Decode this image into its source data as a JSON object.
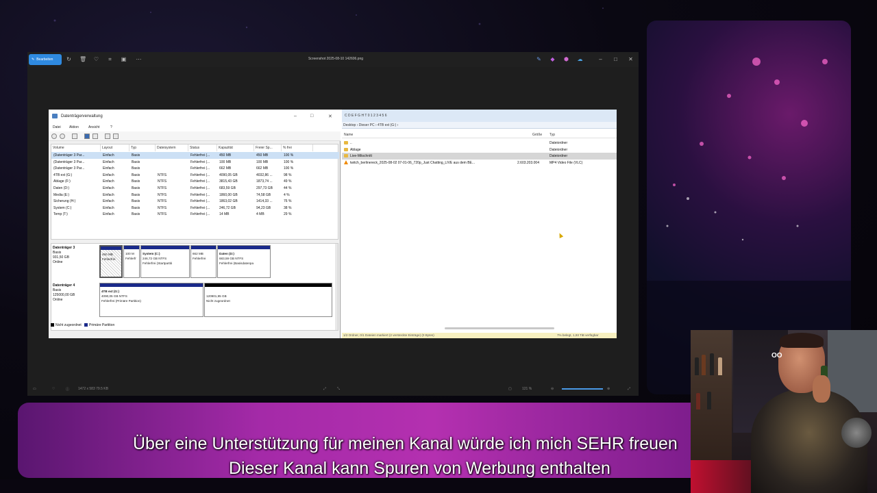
{
  "viewer": {
    "edit_button": "Bearbeiten",
    "title": "Screenshot 2025-08-10 142606.png",
    "status_info": "1472 x 583    79.5 KB",
    "zoom": "121 %"
  },
  "disk_management": {
    "title": "Datenträgerverwaltung",
    "menu": [
      "Datei",
      "Aktion",
      "Ansicht",
      "?"
    ],
    "columns": [
      "Volume",
      "Layout",
      "Typ",
      "Dateisystem",
      "Status",
      "Kapazität",
      "Freier Sp...",
      "% frei"
    ],
    "rows": [
      [
        "(Datenträger 3 Par...",
        "Einfach",
        "Basis",
        "",
        "Fehlerfrei (...",
        "450 MB",
        "450 MB",
        "100 %"
      ],
      [
        "(Datenträger 3 Par...",
        "Einfach",
        "Basis",
        "",
        "Fehlerfrei (...",
        "100 MB",
        "100 MB",
        "100 %"
      ],
      [
        "(Datenträger 3 Par...",
        "Einfach",
        "Basis",
        "",
        "Fehlerfrei (...",
        "662 MB",
        "662 MB",
        "100 %"
      ],
      [
        "4TB ext (G:)",
        "Einfach",
        "Basis",
        "NTFS",
        "Fehlerfrei (...",
        "4090,05 GB",
        "4032,86 ...",
        "98 %"
      ],
      [
        "Ablage (F:)",
        "Einfach",
        "Basis",
        "NTFS",
        "Fehlerfrei (...",
        "3815,43 GB",
        "1873,74 ...",
        "49 %"
      ],
      [
        "Daten (D:)",
        "Einfach",
        "Basis",
        "NTFS",
        "Fehlerfrei (...",
        "683,59 GB",
        "297,73 GB",
        "44 %"
      ],
      [
        "Media (E:)",
        "Einfach",
        "Basis",
        "NTFS",
        "Fehlerfrei (...",
        "1860,00 GB",
        "74,58 GB",
        "4 %"
      ],
      [
        "Sicherung (H:)",
        "Einfach",
        "Basis",
        "NTFS",
        "Fehlerfrei (...",
        "1863,02 GB",
        "1414,33 ...",
        "76 %"
      ],
      [
        "System (C:)",
        "Einfach",
        "Basis",
        "NTFS",
        "Fehlerfrei (...",
        "246,72 GB",
        "94,23 GB",
        "38 %"
      ],
      [
        "Temp (T:)",
        "Einfach",
        "Basis",
        "NTFS",
        "Fehlerfrei (...",
        "14 MB",
        "4 MB",
        "29 %"
      ]
    ],
    "disk3": {
      "name": "Datenträger 3",
      "type": "Basis",
      "size": "931,50 GB",
      "state": "Online",
      "partitions": [
        {
          "l1": "450 MB",
          "l2": "Fehlerfrei",
          "l3": ""
        },
        {
          "l1": "100 M",
          "l2": "Fehlerfr",
          "l3": ""
        },
        {
          "l1": "System (C:)",
          "l2": "246,72 GB NTFS",
          "l3": "Fehlerfrei (Startpartiti"
        },
        {
          "l1": "662 MB",
          "l2": "Fehlerfrei",
          "l3": ""
        },
        {
          "l1": "Daten (D:)",
          "l2": "683,59 GB NTFS",
          "l3": "Fehlerfrei (Basisdatenpa"
        }
      ]
    },
    "disk4": {
      "name": "Datenträger 4",
      "type": "Basis",
      "size": "125000,00 GB",
      "state": "Online",
      "partitions": [
        {
          "l1": "4TB ext (G:)",
          "l2": "4090,05 GB NTFS",
          "l3": "Fehlerfrei (Primäre Partition)"
        },
        {
          "l1": "",
          "l2": "120901,95 GB",
          "l3": "Nicht zugeordnet"
        }
      ]
    },
    "legend": [
      "Nicht zugeordnet",
      "Primäre Partition"
    ]
  },
  "explorer": {
    "toolbar": "C  D  E  F  G  H  T  0  1  2  3  4  5  6",
    "address": "Desktop › Dieser PC › 4TB ext (G:) ›",
    "columns": [
      "Name",
      "Größe",
      "Typ"
    ],
    "rows": [
      {
        "name": "..",
        "size": "",
        "type": "Dateiordner"
      },
      {
        "name": "Ablage",
        "size": "",
        "type": "Dateiordner"
      },
      {
        "name": "Live-Mitschnitt",
        "size": "",
        "type": "Dateiordner"
      },
      {
        "name": "twitch_berlinereck_2025-08-02 07-01-06_720p_Just Chatting_LIVE aus dem BE...",
        "size": "2.603.203.004",
        "type": "MP4 Video File (VLC)"
      }
    ],
    "status_left": "1/2 Ordner, 0/1 Dateien markiert (2 versteckte Einträge) (0 Bytes)",
    "status_right": "7% belegt, 1,93 TiB verfügbar"
  },
  "subtitles": {
    "line1": "Über eine Unterstützung für meinen Kanal würde ich mich SEHR freuen",
    "line2": "Dieser Kanal kann Spuren von Werbung enthalten"
  },
  "webcam": {
    "logo": "OO"
  }
}
